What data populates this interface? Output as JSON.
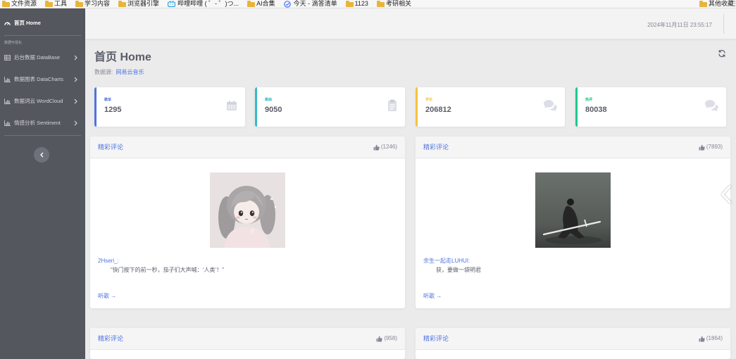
{
  "bookmarks": {
    "items": [
      {
        "label": "文件资源",
        "icon": "folder-icon"
      },
      {
        "label": "工具",
        "icon": "folder-icon"
      },
      {
        "label": "学习内容",
        "icon": "folder-icon"
      },
      {
        "label": "浏览器引擎",
        "icon": "folder-icon"
      },
      {
        "label": "哔哩哔哩 ( ゜- ゜)つ...",
        "icon": "bilibili-icon"
      },
      {
        "label": "AI合集",
        "icon": "folder-icon"
      },
      {
        "label": "今天 - 滴答清单",
        "icon": "check-circle-icon"
      },
      {
        "label": "1123",
        "icon": "folder-icon"
      },
      {
        "label": "考研相关",
        "icon": "folder-icon"
      }
    ],
    "other": {
      "label": "其他收藏夹",
      "icon": "folder-icon"
    }
  },
  "sidebar": {
    "home": {
      "label": "首页 Home",
      "icon": "dashboard-icon"
    },
    "heading": "数据可视化",
    "items": [
      {
        "label": "后台数据 DataBase",
        "icon": "table-icon"
      },
      {
        "label": "数据图表 DataCharts",
        "icon": "chart-bar-icon"
      },
      {
        "label": "数据词云 WordCloud",
        "icon": "chart-bar-icon"
      },
      {
        "label": "情感分析 Sentiment",
        "icon": "chart-bar-icon"
      }
    ],
    "toggle_icon": "chevron-left-icon"
  },
  "topbar": {
    "datetime": "2024年11月11日 23:55:17"
  },
  "page": {
    "title": "首页 Home",
    "source_label": "数据源:",
    "source_link": "网易云音乐",
    "refresh_icon": "refresh-icon"
  },
  "stats": [
    {
      "label": "歌单",
      "value": "1295",
      "color": "#4e73df",
      "icon": "calendar-icon"
    },
    {
      "label": "歌曲",
      "value": "9050",
      "color": "#36b9cc",
      "icon": "clipboard-icon"
    },
    {
      "label": "评论",
      "value": "206812",
      "color": "#f6c23e",
      "icon": "comments-icon"
    },
    {
      "label": "热评",
      "value": "80038",
      "color": "#1cc88a",
      "icon": "comments-icon"
    }
  ],
  "comments": [
    {
      "title": "精彩评论",
      "likes": "(1246)",
      "user": "2Hseri_:",
      "text": "“快门按下的前一秒，茄子们大声喊：‘人类’！”",
      "listen": "听歌 →"
    },
    {
      "title": "精彩评论",
      "likes": "(7893)",
      "user": "余生一起走LUHUI:",
      "text": "获，要做一袋明君",
      "listen": "听歌 →"
    },
    {
      "title": "精彩评论",
      "likes": "(958)"
    },
    {
      "title": "精彩评论",
      "likes": "(1864)"
    }
  ],
  "colors": {
    "sidebar_bg": "#55575f",
    "primary": "#4e73df",
    "page_bg": "#ebebeb"
  }
}
